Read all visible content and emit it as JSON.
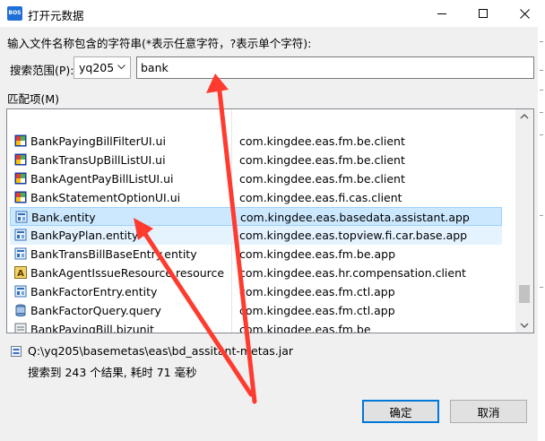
{
  "window": {
    "title": "打开元数据",
    "app_icon_text": "BOS",
    "icon_color": "#1f6fd6"
  },
  "instruction": "输入文件名称包含的字符串(*表示任意字符，?表示单个字符):",
  "scope": {
    "label": "搜索范围(P):",
    "selected": "yq205"
  },
  "search": {
    "value": "bank"
  },
  "matches_label": "匹配项(M)",
  "results": [
    {
      "name": "BankPayingBillFilterUI.ui",
      "package": "com.kingdee.eas.fm.be.client",
      "icon": "ui-icon"
    },
    {
      "name": "BankTransUpBillListUI.ui",
      "package": "com.kingdee.eas.fm.be.client",
      "icon": "ui-icon"
    },
    {
      "name": "BankAgentPayBillListUI.ui",
      "package": "com.kingdee.eas.fm.be.client",
      "icon": "ui-icon"
    },
    {
      "name": "BankStatementOptionUI.ui",
      "package": "com.kingdee.eas.fi.cas.client",
      "icon": "ui-icon"
    },
    {
      "name": "Bank.entity",
      "package": "com.kingdee.eas.basedata.assistant.app",
      "icon": "entity-icon"
    },
    {
      "name": "BankPayPlan.entity",
      "package": "com.kingdee.eas.topview.fi.car.base.app",
      "icon": "entity-icon"
    },
    {
      "name": "BankTransBillBaseEntry.entity",
      "package": "com.kingdee.eas.fm.be.app",
      "icon": "entity-icon"
    },
    {
      "name": "BankAgentIssueResource.resource",
      "package": "com.kingdee.eas.hr.compensation.client",
      "icon": "resource-icon"
    },
    {
      "name": "BankFactorEntry.entity",
      "package": "com.kingdee.eas.fm.ctl.app",
      "icon": "entity-icon"
    },
    {
      "name": "BankFactorQuery.query",
      "package": "com.kingdee.eas.fm.ctl.app",
      "icon": "query-icon"
    },
    {
      "name": "BankPayingBill.bizunit",
      "package": "com.kingdee.eas.fm.be",
      "icon": "bizunit-icon"
    }
  ],
  "path": "Q:\\yq205\\basemetas\\eas\\bd_assitant-metas.jar",
  "status": "搜索到 243 个结果, 耗时  71 毫秒",
  "buttons": {
    "ok": "确定",
    "cancel": "取消"
  },
  "colors": {
    "selection": "#cce8ff",
    "hover": "#e5f3ff",
    "annotation_arrow": "#ff3b30"
  }
}
